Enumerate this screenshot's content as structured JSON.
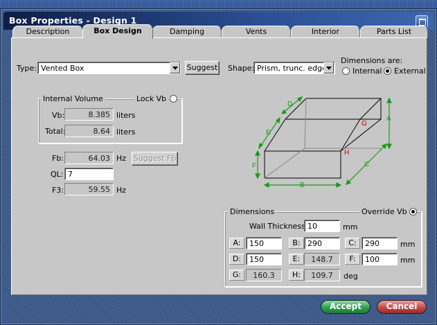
{
  "window": {
    "title": "Box Properties - Design 1"
  },
  "tabs": [
    {
      "label": "Description",
      "active": false
    },
    {
      "label": "Box Design",
      "active": true
    },
    {
      "label": "Damping",
      "active": false
    },
    {
      "label": "Vents",
      "active": false
    },
    {
      "label": "Interior",
      "active": false
    },
    {
      "label": "Parts List",
      "active": false
    }
  ],
  "type": {
    "label": "Type:",
    "value": "Vented Box",
    "suggest_label": "Suggest"
  },
  "shape": {
    "label": "Shape:",
    "value": "Prism, trunc. edge"
  },
  "dimensions_are": {
    "label": "Dimensions are:",
    "internal": "Internal",
    "external": "External",
    "selected": "External"
  },
  "internal_volume": {
    "legend": "Internal Volume",
    "lock_label": "Lock Vb",
    "vb_label": "Vb:",
    "vb_value": "8.385",
    "vb_unit": "liters",
    "total_label": "Total:",
    "total_value": "8.64",
    "total_unit": "liters"
  },
  "tuning": {
    "fb_label": "Fb:",
    "fb_value": "64.03",
    "fb_unit": "Hz",
    "suggest_fb_label": "Suggest Fb",
    "ql_label": "QL:",
    "ql_value": "7",
    "f3_label": "F3:",
    "f3_value": "59.55",
    "f3_unit": "Hz"
  },
  "diagram": {
    "labels": [
      "D",
      "E",
      "F",
      "A",
      "G",
      "H",
      "C",
      "B"
    ]
  },
  "dimensions": {
    "legend": "Dimensions",
    "override_label": "Override Vb",
    "wall_label": "Wall Thickness:",
    "wall_value": "10",
    "wall_unit": "mm",
    "a_label": "A:",
    "a_value": "150",
    "b_label": "B:",
    "b_value": "290",
    "c_label": "C:",
    "c_value": "290",
    "d_label": "D:",
    "d_value": "150",
    "e_label": "E:",
    "e_value": "148.7",
    "f_label": "F:",
    "f_value": "100",
    "g_label": "G:",
    "g_value": "160.3",
    "h_label": "H:",
    "h_value": "109.7",
    "mm_unit": "mm",
    "deg_unit": "deg"
  },
  "footer": {
    "accept_label": "Accept",
    "cancel_label": "Cancel"
  },
  "colors": {
    "accept": "#2f9c52",
    "cancel": "#c24848",
    "panel": "#c7c7c7",
    "diagram_dim": "#1a9a1a",
    "diagram_mark": "#cc0000"
  }
}
